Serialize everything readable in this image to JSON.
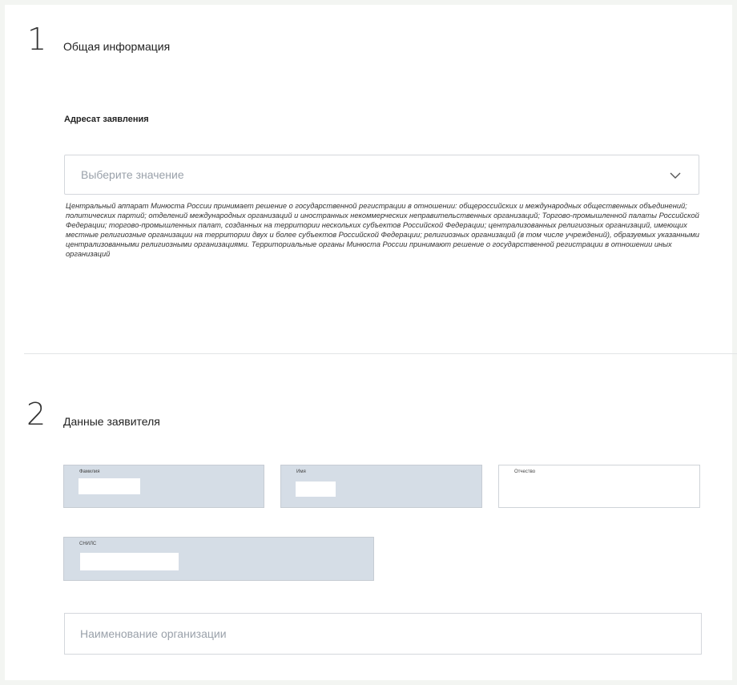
{
  "section1": {
    "number": "1",
    "title": "Общая информация",
    "field_label": "Адресат заявления",
    "select_placeholder": "Выберите значение",
    "hint": "Центральный аппарат Минюста России принимает решение о государственной регистрации в отношении: общероссийских и международных общественных объединений; политических партий; отделений международных организаций и иностранных некоммерческих неправительственных организаций; Торгово-промышленной палаты Российской Федерации; торгово-промышленных палат, созданных на территории нескольких субъектов Российской Федерации; централизованных религиозных организаций, имеющих местные религиозные организации на территории двух и более субъектов Российской Федерации; религиозных организаций (в том числе учреждений), образуемых указанными централизованными религиозными организациями. Территориальные органы Минюста России принимают решение о государственной регистрации в отношении иных организаций"
  },
  "section2": {
    "number": "2",
    "title": "Данные заявителя",
    "surname_label": "Фамилия",
    "name_label": "Имя",
    "patronymic_label": "Отчество",
    "snils_label": "СНИЛС",
    "org_placeholder": "Наименование организации"
  },
  "icons": {
    "select_chevron": "chevron-down-icon"
  },
  "colors": {
    "filled_field": "#d5dde6",
    "border": "#d4d7dc",
    "placeholder": "#9aa1aa"
  }
}
